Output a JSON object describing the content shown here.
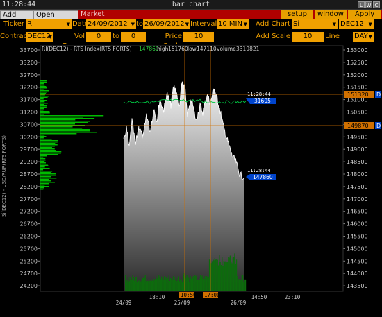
{
  "window": {
    "clock": "11:28:44",
    "title": "bar chart",
    "buttons": [
      "L",
      "W",
      "C"
    ]
  },
  "tabs": [
    {
      "label": "Add Chart",
      "state": "inactive"
    },
    {
      "label": "Open Interest",
      "state": "inactive"
    },
    {
      "label": "Market Watch",
      "state": "active"
    }
  ],
  "actions": {
    "setup": "setup",
    "window": "window",
    "apply": "Apply"
  },
  "controls": {
    "ticker_label": "Ticker",
    "ticker": "RI",
    "date_label": "Date",
    "date_from": "24/09/2012",
    "date_to_label": "to",
    "date_to": "26/09/2012",
    "interval_label": "Interval",
    "interval": "10 MIN",
    "add_chart_label": "Add Chart",
    "add_chart": "Si",
    "add_chart_contract": "DEC12",
    "contract_label": "Contract",
    "contract": "DEC12",
    "vol_range_label": "Vol Range",
    "vol_from": "0",
    "vol_to_label": "to",
    "vol_to": "0",
    "price_scale_label": "Price Scale",
    "price_scale": "10",
    "add_scale_label": "Add Scale",
    "add_scale": "10",
    "line_label": "Line",
    "line": "DAY"
  },
  "info": {
    "symbol": "RI(DEC12) - RTS Index(RTS FORTS)",
    "last": "147860",
    "high_label": "high",
    "high": "151760",
    "low_label": "low",
    "low": "147110",
    "volume_label": "volume",
    "volume": "3319821"
  },
  "left_axis_title": "Si(DEC12) - USD/RUR(RTS FORTS)",
  "left_ticks": [
    "33700",
    "33200",
    "32700",
    "32200",
    "31700",
    "31200",
    "30700",
    "30200",
    "29700",
    "29200",
    "28700",
    "28200",
    "27700",
    "27200",
    "26700",
    "26200",
    "25700",
    "25200",
    "24700",
    "24200"
  ],
  "right_ticks": [
    "153000",
    "152500",
    "152000",
    "151500",
    "151000",
    "150500",
    "150000",
    "149500",
    "149000",
    "148500",
    "148000",
    "147500",
    "147000",
    "146500",
    "146000",
    "145500",
    "145000",
    "144500",
    "144000",
    "143500"
  ],
  "x_top": [
    "18:10",
    "14:50",
    "23:10"
  ],
  "x_bottom": [
    "24/09",
    "25/09",
    "26/09"
  ],
  "markers": {
    "cursor_time_1": "10:50",
    "cursor_time_2": "17:00",
    "price_h1": "151320",
    "price_h2": "149870",
    "si_time": "11:28:44",
    "si_last": "31605",
    "ri_time": "11:28:44",
    "ri_last": "147860",
    "d": "D"
  },
  "colors": {
    "si_line": "#00cc44",
    "volume": "#0d6b0d",
    "profile": "#00bb00",
    "orange": "#d07000",
    "tag_blue": "#0044cc"
  }
}
